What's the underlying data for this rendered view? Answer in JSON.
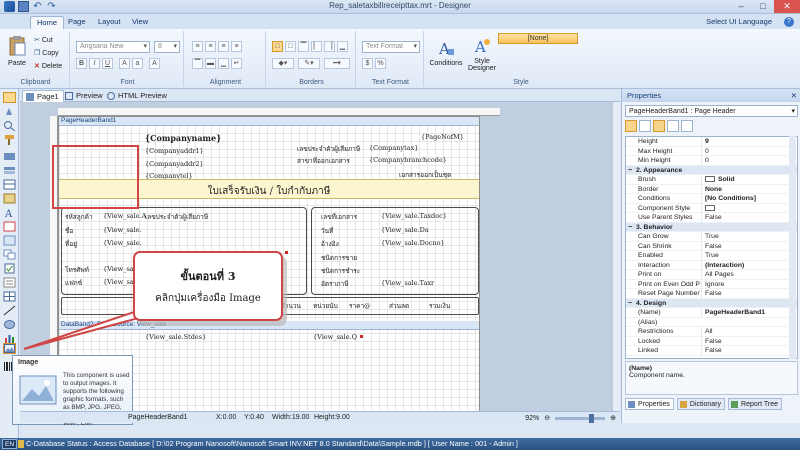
{
  "window": {
    "title": "Rep_saletaxbillreceipttax.mrt - Designer",
    "controls": [
      "–",
      "□",
      "✕"
    ]
  },
  "ribbon": {
    "tabs": [
      "Home",
      "Page",
      "Layout",
      "View"
    ],
    "ui_language": "Select UI Language",
    "clipboard": {
      "paste": "Paste",
      "cut": "Cut",
      "copy": "Copy",
      "delete": "Delete",
      "label": "Clipboard"
    },
    "font": {
      "name": "Angsana New",
      "size": "8",
      "bold": "B",
      "italic": "I",
      "underline": "U",
      "label": "Font"
    },
    "alignment": {
      "label": "Alignment"
    },
    "borders": {
      "label": "Borders"
    },
    "text_format": {
      "value": "Text Format",
      "label": "Text Format"
    },
    "style": {
      "conditions": "Conditions",
      "style_designer_1": "Style",
      "style_designer_2": "Designer",
      "current": "[None]",
      "label": "Style"
    }
  },
  "page_tabs": [
    "Page1",
    "Preview",
    "HTML Preview"
  ],
  "report": {
    "page_header_band": "PageHeaderBand1",
    "company_name": "{Companyname}",
    "company_addr1": "{Companyaddr1}",
    "company_addr2": "{Companyaddr2}",
    "company_tel": "{Companytel}",
    "page_no": "{PageNofM}",
    "tax_label": "เลขประจำตัวผู้เสียภาษี",
    "tax_value": "{Companytax}",
    "branch_label": "สาขาที่ออกเอกสาร",
    "branch_value": "{Companybranchcode}",
    "issued_as": "เอกสารออกเป็นชุด",
    "title": "ใบเสร็จรับเงิน / ใบกำกับภาษี",
    "cust_code_label": "รหัสลูกค้า",
    "cust_code_value": "{View_sale.A",
    "cust_tax_label": "เลขประจำตัวผู้เสียภาษี",
    "name_label": "ชื่อ",
    "name_value": "{View_sale.",
    "address_label": "ที่อยู่",
    "address_value": "{View_sale.",
    "phone_label": "โทรศัพท์",
    "phone_value": "{View_sale.",
    "fax_label": "แฟกซ์",
    "fax_value": "{View_sale.",
    "doc_no_label": "เลขที่เอกสาร",
    "doc_no_value": "{View_sale.Taxdoc}",
    "date_label": "วันที่",
    "date_value": "{View_sale.Da",
    "ref_label": "อ้างอิง",
    "ref_value": "{View_sale.Docno}",
    "pay_type_label": "ชนิดการขาย",
    "pay_label": "ชนิดการชำระ",
    "tax_id_label": "อัตราภาษี",
    "tax_id_value": "{View_sale.Taxr",
    "col_qty": "จำนวน",
    "col_unit": "หน่วยนับ",
    "col_price": "ราคา@",
    "col_discount": "ส่วนลด",
    "col_total": "รวมเงิน",
    "data_band": "DataBand2; Data Source: View_sale",
    "detail_1": "{View_sale.Stdes}",
    "detail_2": "{View_sale.Q"
  },
  "callout": {
    "step": "ขั้นตอนที่ 3",
    "instruction": "คลิกปุ่มเครื่องมือ Image"
  },
  "tooltip": {
    "title": "Image",
    "description": "This component is used to output images. It supports the following graphic formats, such as BMP, JPG, JPEG, GIF, TIFF, PNG, ICO, WMF, EMF."
  },
  "design_status": {
    "component": "PageHeaderBand1",
    "x": "X:0.00",
    "y": "Y:0.40",
    "width": "Width:19.00",
    "height": "Height:9.00",
    "zoom": "92%"
  },
  "properties": {
    "title": "Properties",
    "selected": "PageHeaderBand1 : Page Header",
    "rows": [
      {
        "name": "Height",
        "value": "9",
        "bold": true
      },
      {
        "name": "Max Height",
        "value": "0"
      },
      {
        "name": "Min Height",
        "value": "0"
      },
      {
        "category": "2. Appearance"
      },
      {
        "name": "Brush",
        "value": "Solid",
        "bold": true,
        "swatch": "#ffffff"
      },
      {
        "name": "Border",
        "value": "None",
        "bold": true
      },
      {
        "name": "Conditions",
        "value": "[No Conditions]",
        "bold": true
      },
      {
        "name": "Component Style",
        "value": "",
        "swatch": "#ffffff"
      },
      {
        "name": "Use Parent Styles",
        "value": "False"
      },
      {
        "category": "3. Behavior"
      },
      {
        "name": "Can Grow",
        "value": "True"
      },
      {
        "name": "Can Shrink",
        "value": "False"
      },
      {
        "name": "Enabled",
        "value": "True"
      },
      {
        "name": "Interaction",
        "value": "(Interaction)",
        "bold": true
      },
      {
        "name": "Print on",
        "value": "All Pages"
      },
      {
        "name": "Print on Even Odd Pa",
        "value": "Ignore"
      },
      {
        "name": "Reset Page Number",
        "value": "False"
      },
      {
        "category": "4. Design"
      },
      {
        "name": "(Name)",
        "value": "PageHeaderBand1",
        "bold": true
      },
      {
        "name": "(Alias)",
        "value": ""
      },
      {
        "name": "Restrictions",
        "value": "All"
      },
      {
        "name": "Locked",
        "value": "False"
      },
      {
        "name": "Linked",
        "value": "False"
      }
    ],
    "desc_name": "(Name)",
    "desc_text": "Component name.",
    "tabs": [
      "Properties",
      "Dictionary",
      "Report Tree"
    ]
  },
  "statusbar": {
    "language": "EN",
    "message": "C-Database Status : Access Database [ D:\\02 Program Nanosoft\\Nanosoft Smart INV.NET 8.0 Standard\\Data\\Sample.mdb ]  [ User Name : 001 - Admin ]"
  }
}
